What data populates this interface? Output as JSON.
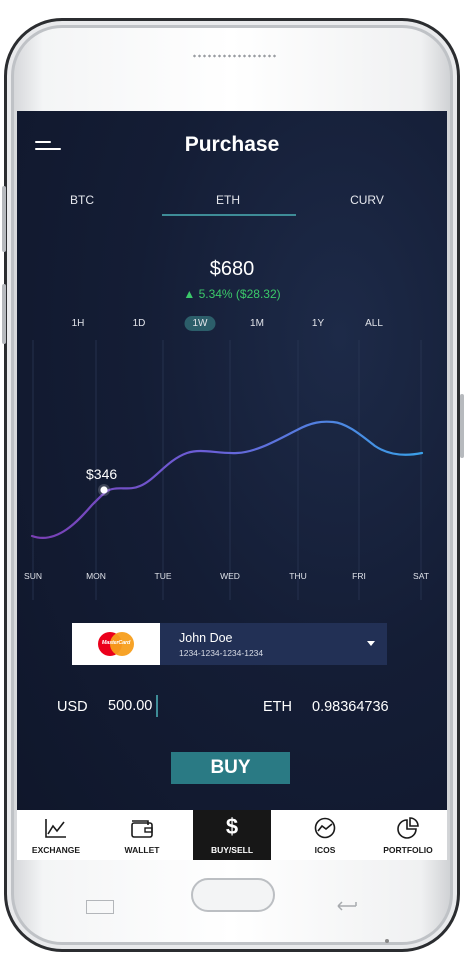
{
  "app": {
    "title": "Purchase"
  },
  "tabs": [
    {
      "label": "BTC",
      "active": false
    },
    {
      "label": "ETH",
      "active": true
    },
    {
      "label": "CURV",
      "active": false
    }
  ],
  "price": {
    "value": "$680",
    "change": "▲ 5.34% ($28.32)",
    "change_color": "#3bc86a"
  },
  "ranges": [
    {
      "label": "1H",
      "active": false
    },
    {
      "label": "1D",
      "active": false
    },
    {
      "label": "1W",
      "active": true
    },
    {
      "label": "1M",
      "active": false
    },
    {
      "label": "1Y",
      "active": false
    },
    {
      "label": "ALL",
      "active": false
    }
  ],
  "chart_data": {
    "type": "line",
    "categories": [
      "SUN",
      "MON",
      "TUE",
      "WED",
      "THU",
      "FRI",
      "SAT"
    ],
    "highlight": {
      "category": "MON",
      "label": "$346"
    },
    "grid": "vertical",
    "colors": {
      "start": "#7a3fb4",
      "mid": "#6b5fd8",
      "end": "#3aa0e8"
    }
  },
  "card": {
    "brand": "MasterCard",
    "name": "John Doe",
    "number": "1234-1234-1234-1234"
  },
  "amounts": {
    "from_currency": "USD",
    "from_value": "500.00",
    "to_currency": "ETH",
    "to_value": "0.98364736"
  },
  "buy_label": "BUY",
  "nav": [
    {
      "label": "EXCHANGE",
      "icon": "line-chart-icon",
      "active": false
    },
    {
      "label": "WALLET",
      "icon": "wallet-icon",
      "active": false
    },
    {
      "label": "BUY/SELL",
      "icon": "dollar-icon",
      "active": true
    },
    {
      "label": "ICOS",
      "icon": "trend-circle-icon",
      "active": false
    },
    {
      "label": "PORTFOLIO",
      "icon": "pie-chart-icon",
      "active": false
    }
  ]
}
